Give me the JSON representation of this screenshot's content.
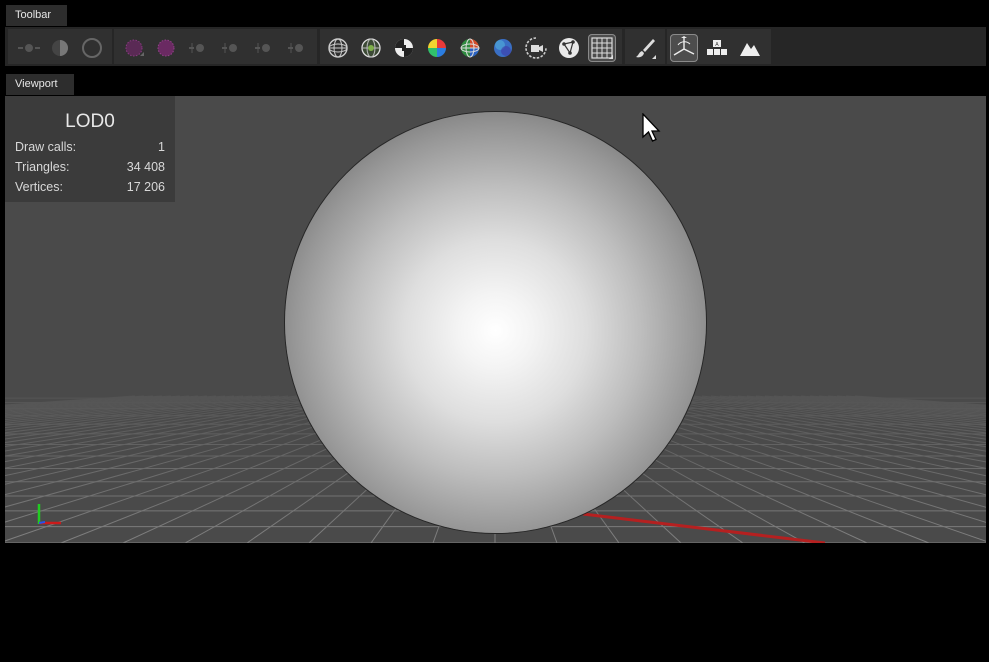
{
  "toolbar": {
    "tab_label": "Toolbar"
  },
  "viewport": {
    "tab_label": "Viewport",
    "stats": {
      "lod": "LOD0",
      "draw_calls_label": "Draw calls:",
      "draw_calls_value": "1",
      "triangles_label": "Triangles:",
      "triangles_value": "34 408",
      "vertices_label": "Vertices:",
      "vertices_value": "17 206"
    }
  },
  "toolbar_icons": [
    "light-dim-icon",
    "half-circle-icon",
    "ring-icon",
    "magenta-sphere-icon",
    "magenta-sphere-2-icon",
    "light-a-icon",
    "light-b-icon",
    "light-c-icon",
    "light-d-icon",
    "wireframe-sphere-icon",
    "green-sphere-icon",
    "checker-icon",
    "color-wheel-icon",
    "uv-sphere-icon",
    "normal-sphere-icon",
    "camera-icon",
    "vertex-graph-icon",
    "grid-icon",
    "brush-icon",
    "gizmo-icon",
    "labels-icon",
    "terrain-icon"
  ],
  "colors": {
    "accent_x_axis": "#cc1a1a",
    "accent_y_axis": "#22cc22"
  }
}
